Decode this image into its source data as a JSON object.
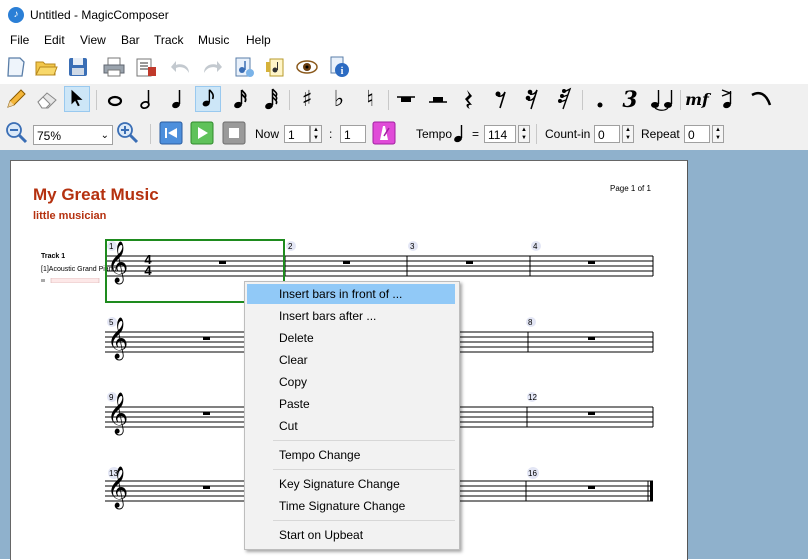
{
  "window": {
    "title": "Untitled - MagicComposer"
  },
  "menu": [
    "File",
    "Edit",
    "View",
    "Bar",
    "Track",
    "Music",
    "Help"
  ],
  "toolbar3": {
    "zoom_value": "75%",
    "now_label": "Now",
    "now_bar": "1",
    "now_beat": "1",
    "tempo_label": "Tempo",
    "tempo_equals": "=",
    "tempo_value": "114",
    "countin_label": "Count-in",
    "countin_value": "0",
    "repeat_label": "Repeat",
    "repeat_value": "0",
    "colon": ":"
  },
  "score": {
    "title": "My Great Music",
    "subtitle": "little musician",
    "page_number": "Page 1 of 1",
    "track_name": "Track 1",
    "instrument": "[1]Acoustic Grand Piano",
    "time_signature": {
      "top": "4",
      "bottom": "4"
    },
    "bar_numbers": [
      "1",
      "2",
      "3",
      "4",
      "5",
      "8",
      "9",
      "12",
      "13",
      "16"
    ]
  },
  "context_menu": {
    "items": [
      "Insert bars in front of ...",
      "Insert bars after ...",
      "Delete",
      "Clear",
      "Copy",
      "Paste",
      "Cut",
      "Tempo Change",
      "Key Signature Change",
      "Time Signature Change",
      "Start on Upbeat"
    ],
    "highlighted_index": 0
  },
  "colors": {
    "title_red": "#b5310f",
    "workspace_blue": "#8fb1cc",
    "selection_green": "#1e8b1e",
    "menu_highlight": "#91c9f7",
    "icon_selected": "#cde6f7"
  },
  "icons": {
    "toolbar1": [
      "new-file-icon",
      "open-folder-icon",
      "save-icon",
      "print-icon",
      "print-preview-icon",
      "undo-icon",
      "redo-icon",
      "music-export-icon",
      "music-settings-icon",
      "view-eye-icon",
      "info-icon"
    ],
    "toolbar2": [
      "pencil-icon",
      "eraser-icon",
      "pointer-icon",
      "whole-note-icon",
      "half-note-icon",
      "quarter-note-icon",
      "eighth-note-icon",
      "sixteenth-note-icon",
      "thirty-second-note-icon",
      "sharp-icon",
      "flat-icon",
      "natural-icon",
      "whole-rest-icon",
      "half-rest-icon",
      "quarter-rest-icon",
      "eighth-rest-icon",
      "sixteenth-rest-icon",
      "thirty-second-rest-icon",
      "dot-icon",
      "triplet-icon",
      "tie-icon",
      "dynamics-icon",
      "accent-icon",
      "slur-icon"
    ],
    "toolbar3": [
      "zoom-out-icon",
      "zoom-in-icon",
      "rewind-icon",
      "play-icon",
      "stop-icon",
      "metronome-icon",
      "quarter-note-tempo-icon"
    ]
  }
}
